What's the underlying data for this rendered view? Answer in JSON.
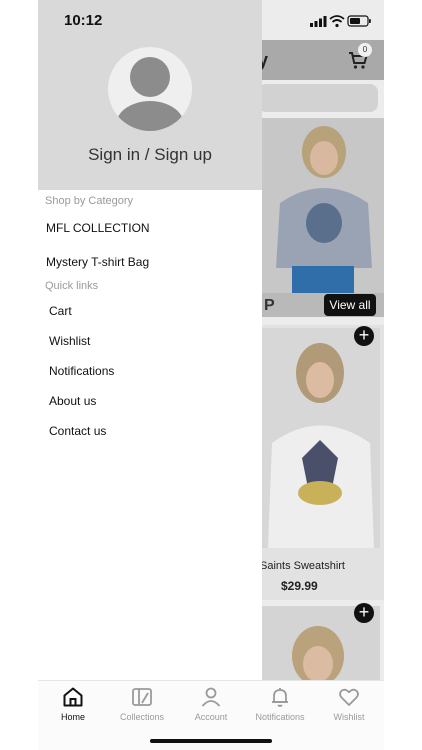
{
  "status_bar": {
    "time": "10:12"
  },
  "drawer": {
    "sign_in": "Sign in / Sign up",
    "shop_by_category_label": "Shop by Category",
    "categories": [
      "MFL COLLECTION",
      "Mystery T-shirt Bag"
    ],
    "quick_links_label": "Quick links",
    "quick_links": [
      "Cart",
      "Wishlist",
      "Notifications",
      "About us",
      "Contact us"
    ]
  },
  "background_screen": {
    "header_title_fragment": "y",
    "cart_count": "0",
    "section_title_fragment": "P",
    "view_all_label": "View all",
    "product": {
      "name": "Saints Sweatshirt",
      "price": "$29.99"
    }
  },
  "bottom_nav": {
    "items": [
      {
        "label": "Home",
        "icon": "home-icon",
        "active": true
      },
      {
        "label": "Collections",
        "icon": "collections-icon",
        "active": false
      },
      {
        "label": "Account",
        "icon": "account-icon",
        "active": false
      },
      {
        "label": "Notifications",
        "icon": "bell-icon",
        "active": false
      },
      {
        "label": "Wishlist",
        "icon": "heart-icon",
        "active": false
      }
    ]
  },
  "colors": {
    "drawer_header": "#d9d9d9",
    "accent": "#111111",
    "muted_text": "#9a9a9a"
  }
}
